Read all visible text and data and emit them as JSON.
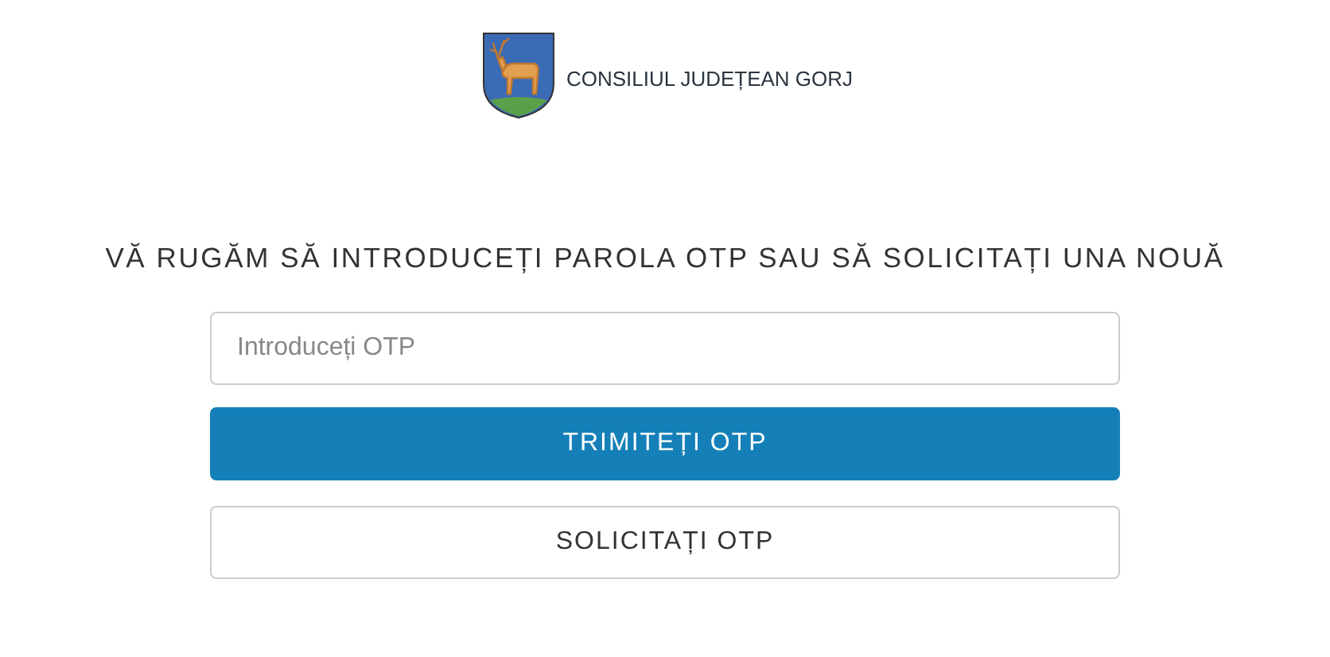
{
  "header": {
    "org_name": "CONSILIUL JUDEȚEAN GORJ"
  },
  "heading": "VĂ RUGĂM SĂ INTRODUCEȚI PAROLA OTP SAU SĂ SOLICITAȚI UNA NOUĂ",
  "otp_field": {
    "placeholder": "Introduceți OTP"
  },
  "buttons": [
    {
      "label": "TRIMITEȚI OTP",
      "kind": "primary"
    },
    {
      "label": "SOLICITAȚI OTP",
      "kind": "secondary"
    }
  ]
}
